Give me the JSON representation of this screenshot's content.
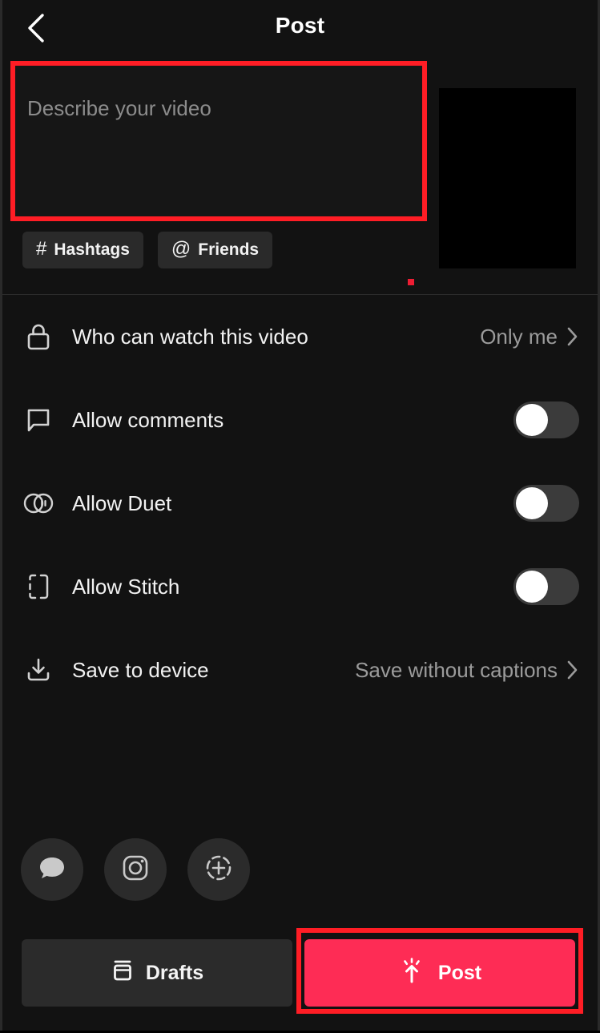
{
  "header": {
    "title": "Post",
    "back_icon": "chevron-left-icon"
  },
  "compose": {
    "description_value": "",
    "description_placeholder": "Describe your video",
    "chips": [
      {
        "icon": "hash-icon",
        "glyph": "#",
        "label": "Hashtags"
      },
      {
        "icon": "at-icon",
        "glyph": "@",
        "label": "Friends"
      }
    ],
    "thumbnail_alt": "video-thumbnail"
  },
  "settings": {
    "rows": [
      {
        "icon": "lock-icon",
        "label": "Who can watch this video",
        "control": "value",
        "value": "Only me",
        "chevron": true
      },
      {
        "icon": "comment-bubble-icon",
        "label": "Allow comments",
        "control": "toggle",
        "toggle_on": false
      },
      {
        "icon": "duet-icon",
        "label": "Allow Duet",
        "control": "toggle",
        "toggle_on": false
      },
      {
        "icon": "stitch-icon",
        "label": "Allow Stitch",
        "control": "toggle",
        "toggle_on": false
      },
      {
        "icon": "download-icon",
        "label": "Save to device",
        "control": "value",
        "value": "Save without captions",
        "chevron": true
      }
    ]
  },
  "share": {
    "buttons": [
      {
        "icon": "message-bubble-icon",
        "name": "share-messages"
      },
      {
        "icon": "instagram-icon",
        "name": "share-instagram"
      },
      {
        "icon": "instagram-story-icon",
        "name": "share-instagram-story"
      }
    ]
  },
  "bottom_bar": {
    "drafts_label": "Drafts",
    "drafts_icon": "archive-box-icon",
    "post_label": "Post",
    "post_icon": "post-arrow-icon"
  },
  "colors": {
    "background": "#121212",
    "surface": "#2b2b2b",
    "accent_post": "#fe2c55",
    "annotation": "#ff1d25",
    "text_primary": "#f2f2f2",
    "text_secondary": "#9b9b9b",
    "toggle_track_off": "#3b3b3b",
    "toggle_knob": "#ffffff"
  }
}
